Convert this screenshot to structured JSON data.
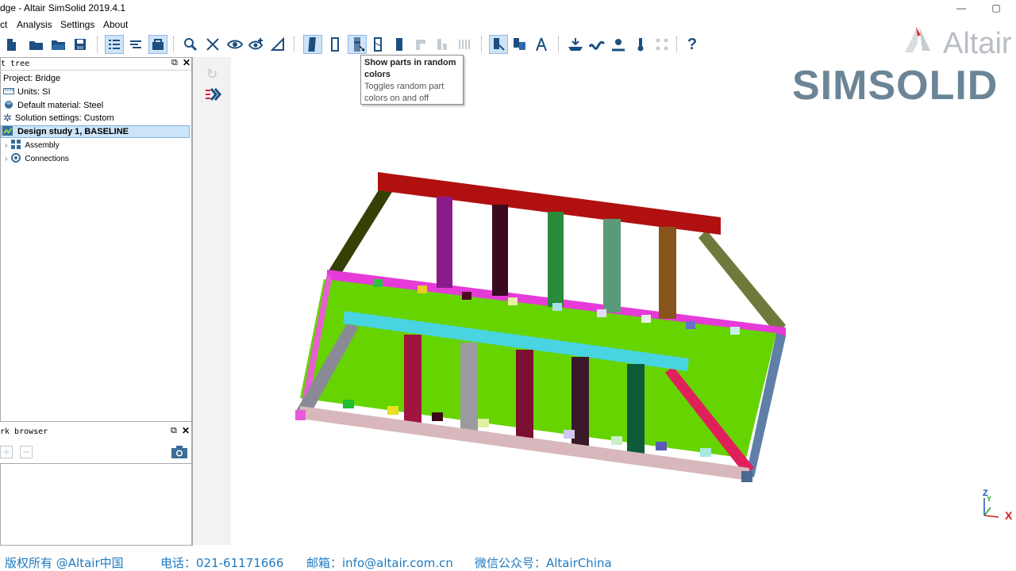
{
  "window": {
    "title": "dge - Altair SimSolid 2019.4.1",
    "minimize_glyph": "—",
    "maximize_glyph": "▢"
  },
  "menu": [
    "ct",
    "Analysis",
    "Settings",
    "About"
  ],
  "toolbar": {
    "buttons": [
      "new-icon",
      "open-folder-icon",
      "open-icon",
      "save-icon",
      "list-icon",
      "lines-icon",
      "toolbox-icon",
      "inspect-icon",
      "scissor-icon",
      "eye-icon",
      "eye-plus-icon",
      "ruler-icon",
      "bar-solid-icon",
      "rect-outline-icon",
      "random-colors-icon",
      "hatched-icon",
      "bar-dark-icon",
      "faded-1-icon",
      "faded-2-icon",
      "faded-3-icon",
      "part-select-icon",
      "part-multi-icon",
      "measure-icon",
      "load-icon",
      "wave-icon",
      "bolt-icon",
      "thermo-icon",
      "nodes-icon",
      "help-icon"
    ],
    "help_glyph": "?"
  },
  "tooltip": {
    "title": "Show parts in random colors",
    "description": "Toggles random part colors on and off"
  },
  "project_tree": {
    "header": "t tree",
    "items": [
      {
        "label": "Project: Bridge",
        "icon": "none"
      },
      {
        "label": "Units: SI",
        "icon": "ruler-icon"
      },
      {
        "label": "Default material: Steel",
        "icon": "material-icon"
      },
      {
        "label": "Solution settings: Custom",
        "icon": "gear-icon"
      },
      {
        "label": "Design study 1, BASELINE",
        "icon": "study-icon"
      },
      {
        "label": "Assembly",
        "icon": "assembly-icon"
      },
      {
        "label": "Connections",
        "icon": "connections-icon"
      }
    ]
  },
  "workbrowser": {
    "header": "rk browser"
  },
  "logos": {
    "altair": "Altair",
    "simsolid": "SIMSOLID"
  },
  "footer": {
    "copyright": "版权所有 @Altair中国",
    "phone": "电话：021-61171666",
    "email": "邮箱：info@altair.com.cn",
    "wechat": "微信公众号：AltairChina"
  },
  "axes": {
    "z": "Z",
    "y": "Y",
    "x": "X"
  }
}
